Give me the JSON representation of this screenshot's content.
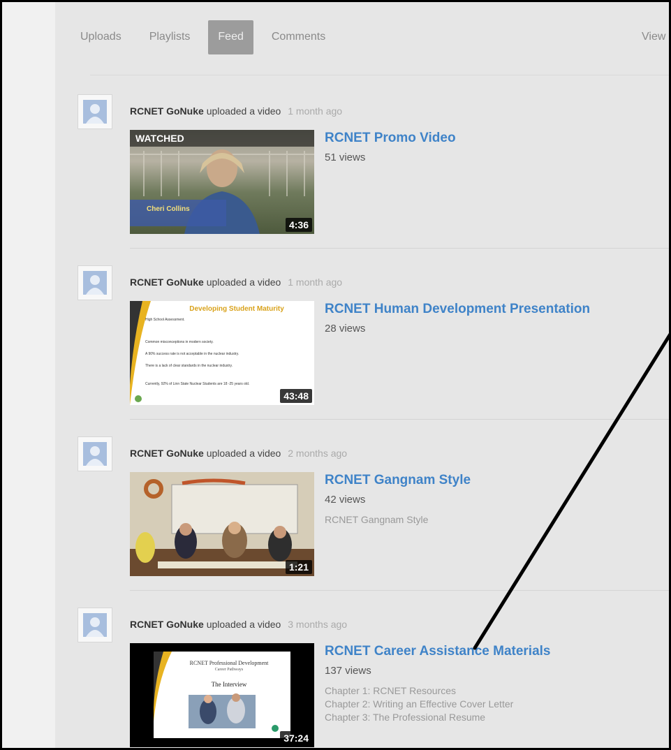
{
  "tabs": [
    {
      "label": "Uploads",
      "active": false
    },
    {
      "label": "Playlists",
      "active": false
    },
    {
      "label": "Feed",
      "active": true
    },
    {
      "label": "Comments",
      "active": false
    }
  ],
  "view_link": "View",
  "feed": [
    {
      "user": "RCNET GoNuke",
      "action": "uploaded a video",
      "time": "1 month ago",
      "title": "RCNET Promo Video",
      "views": "51 views",
      "duration": "4:36",
      "watched_label": "WATCHED",
      "thumb_caption": "Cheri Collins",
      "description": []
    },
    {
      "user": "RCNET GoNuke",
      "action": "uploaded a video",
      "time": "1 month ago",
      "title": "RCNET Human Development Presentation",
      "views": "28 views",
      "duration": "43:48",
      "thumb_heading": "Developing Student Maturity",
      "thumb_bullets": [
        "High School Assessment.",
        "Common misconceptions in modern society.",
        "A 90% success rate is not acceptable in the nuclear industry.",
        "There is a lack of clear standards in the nuclear industry.",
        "Currently, 92% of Linn State Nuclear Students are 18 -25 years old."
      ],
      "description": []
    },
    {
      "user": "RCNET GoNuke",
      "action": "uploaded a video",
      "time": "2 months ago",
      "title": "RCNET Gangnam Style",
      "views": "42 views",
      "duration": "1:21",
      "description": [
        "RCNET Gangnam Style"
      ]
    },
    {
      "user": "RCNET GoNuke",
      "action": "uploaded a video",
      "time": "3 months ago",
      "title": "RCNET Career Assistance Materials",
      "views": "137 views",
      "duration": "37:24",
      "thumb_heading": "RCNET Professional Development",
      "thumb_sub": "Career Pathways",
      "thumb_title": "The Interview",
      "description": [
        "Chapter 1: RCNET Resources",
        "Chapter 2: Writing an Effective Cover Letter",
        "Chapter 3: The Professional Resume"
      ]
    }
  ],
  "colors": {
    "link": "#3f83c8",
    "active_tab": "#9c9c9c",
    "background": "#e6e6e6"
  }
}
